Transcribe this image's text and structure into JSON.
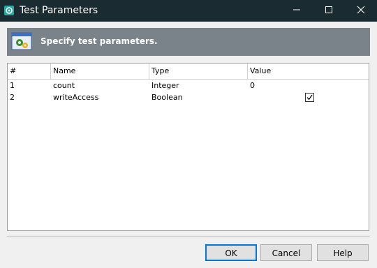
{
  "window": {
    "title": "Test Parameters",
    "icon": "app-gear-icon",
    "controls": [
      "minimize-icon",
      "maximize-icon",
      "close-icon"
    ]
  },
  "header": {
    "icon": "parameters-icon",
    "text": "Specify test parameters."
  },
  "grid": {
    "columns": [
      "#",
      "Name",
      "Type",
      "Value"
    ],
    "rows": [
      {
        "index": "1",
        "name": "count",
        "type": "Integer",
        "value": "0"
      },
      {
        "index": "2",
        "name": "writeAccess",
        "type": "Boolean",
        "value_checked": true
      }
    ]
  },
  "buttons": {
    "ok": "OK",
    "cancel": "Cancel",
    "help": "Help"
  },
  "colors": {
    "titlebar": "#1b2b32",
    "header_band": "#7b838a",
    "default_button_border": "#0078d7"
  }
}
